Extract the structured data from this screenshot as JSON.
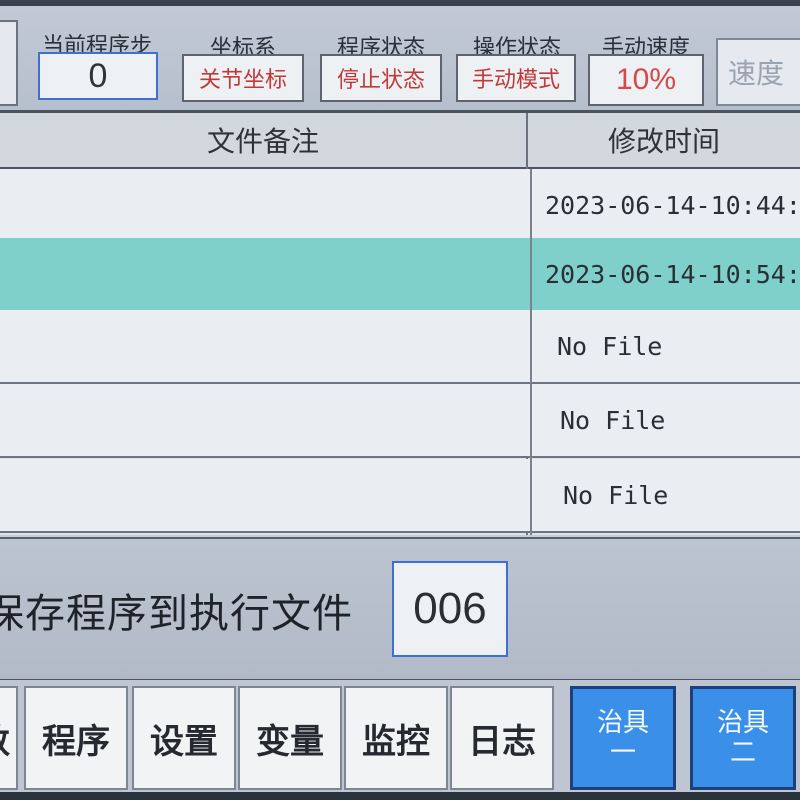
{
  "status": {
    "program_step": {
      "label": "当前程序步",
      "value": "0"
    },
    "coord_system": {
      "label": "坐标系",
      "value": "关节坐标"
    },
    "program_state": {
      "label": "程序状态",
      "value": "停止状态"
    },
    "operation_state": {
      "label": "操作状态",
      "value": "手动模式"
    },
    "manual_speed": {
      "label": "手动速度",
      "value": "10%"
    },
    "speed_button": "速度"
  },
  "table": {
    "columns": [
      "文件备注",
      "修改时间"
    ],
    "rows": [
      {
        "note": "",
        "time": "2023-06-14-10:44:",
        "selected": false
      },
      {
        "note": "",
        "time": "2023-06-14-10:54:",
        "selected": true
      },
      {
        "note": "",
        "time": "No File",
        "selected": false
      },
      {
        "note": "",
        "time": "No File",
        "selected": false
      },
      {
        "note": "",
        "time": "No File",
        "selected": false
      }
    ]
  },
  "save": {
    "label": "保存程序到执行文件",
    "value": "006"
  },
  "nav": {
    "partial": "数",
    "program": "程序",
    "settings": "设置",
    "variables": "变量",
    "monitor": "监控",
    "log": "日志",
    "fixture1_line1": "治具",
    "fixture1_line2": "一",
    "fixture2_line1": "治具",
    "fixture2_line2": "二"
  },
  "colors": {
    "selected_row": "#7fcfca",
    "fixture_button": "#3a8fe8",
    "status_text": "#c13a3a"
  }
}
